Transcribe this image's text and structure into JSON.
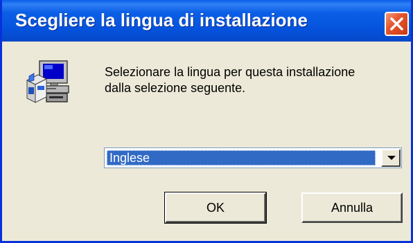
{
  "window": {
    "title": "Scegliere la lingua di installazione"
  },
  "message": {
    "line1": "Selezionare la lingua per questa installazione",
    "line2": "dalla selezione seguente."
  },
  "language_select": {
    "selected": "Inglese"
  },
  "buttons": {
    "ok_label": "OK",
    "cancel_label": "Annulla"
  },
  "icons": {
    "app": "computer-setup-icon",
    "close": "close-icon",
    "dropdown": "chevron-down-icon"
  },
  "colors": {
    "titlebar": "#0553dd",
    "close_button": "#e5562e",
    "selection": "#316ac5",
    "dialog_bg": "#ece9d8"
  }
}
